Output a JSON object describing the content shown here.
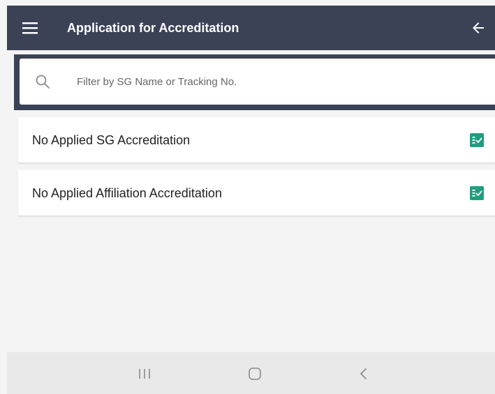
{
  "header": {
    "title": "Application for Accreditation",
    "menu_icon": "hamburger-menu-icon",
    "back_icon": "arrow-left-icon"
  },
  "search": {
    "placeholder": "Filter by SG Name or Tracking No.",
    "value": "",
    "icon": "search-icon"
  },
  "list": {
    "items": [
      {
        "label": "No Applied SG Accreditation",
        "icon": "checklist-icon"
      },
      {
        "label": "No Applied Affiliation Accreditation",
        "icon": "checklist-icon"
      }
    ]
  },
  "system_nav": {
    "recents_icon": "recents-icon",
    "home_icon": "home-icon",
    "back_icon": "system-back-icon"
  },
  "colors": {
    "app_bar": "#3b4256",
    "accent_icon": "#1f9e7f",
    "background": "#f4f4f4",
    "nav_bar": "#e9e9e9"
  }
}
